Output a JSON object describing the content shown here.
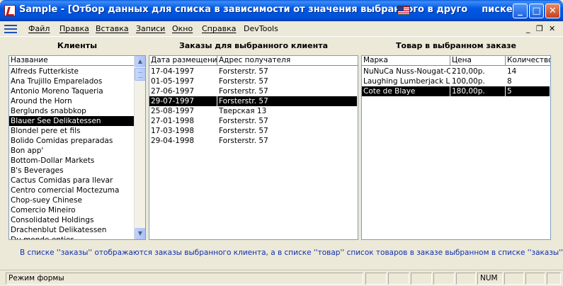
{
  "window": {
    "title_part1": "Sample - [Отбор данных для списка в зависимости от значения выбранного в друго",
    "title_part2": "писке]",
    "min_glyph": "_",
    "max_glyph": "□",
    "close_glyph": "✕"
  },
  "menu": {
    "items": [
      "Файл",
      "Правка",
      "Вставка",
      "Записи",
      "Окно",
      "Справка",
      "DevTools"
    ],
    "mdi_min": "_",
    "mdi_restore": "❐",
    "mdi_close": "✕"
  },
  "clients": {
    "title": "Клиенты",
    "header": "Название",
    "items": [
      "Alfreds Futterkiste",
      "Ana Trujillo Emparelados",
      "Antonio Moreno Taqueria",
      "Around the Horn",
      "Berglunds snabbkop",
      "Blauer See Delikatessen",
      "Blondel pere et fils",
      "Bolido Comidas preparadas",
      "Bon app'",
      "Bottom-Dollar Markets",
      "B's Beverages",
      "Cactus Comidas para llevar",
      "Centro comercial Moctezuma",
      "Chop-suey Chinese",
      "Comercio Mineiro",
      "Consolidated Holdings",
      "Drachenblut Delikatessen",
      "Du monde entier"
    ],
    "selected_index": 5,
    "scroll_up": "▲",
    "scroll_down": "▼"
  },
  "orders": {
    "title": "Заказы для выбранного клиента",
    "headers": [
      "Дата размещения",
      "Адрес получателя"
    ],
    "rows": [
      [
        "17-04-1997",
        "Forsterstr. 57"
      ],
      [
        "01-05-1997",
        "Forsterstr. 57"
      ],
      [
        "27-06-1997",
        "Forsterstr. 57"
      ],
      [
        "29-07-1997",
        "Forsterstr. 57"
      ],
      [
        "25-08-1997",
        "Тверская 13"
      ],
      [
        "27-01-1998",
        "Forsterstr. 57"
      ],
      [
        "17-03-1998",
        "Forsterstr. 57"
      ],
      [
        "29-04-1998",
        "Forsterstr. 57"
      ]
    ],
    "selected_index": 3
  },
  "products": {
    "title": "Товар в выбранном заказе",
    "headers": [
      "Марка",
      "Цена",
      "Количество"
    ],
    "rows": [
      [
        "NuNuCa Nuss-Nougat-Creme",
        "210,00р.",
        "14"
      ],
      [
        "Laughing Lumberjack Lager",
        "100,00р.",
        "8"
      ],
      [
        "Cote de Blaye",
        "180,00р.",
        "5"
      ]
    ],
    "selected_index": 2
  },
  "info_text": "В списке ''заказы'' отображаются заказы выбранного клиента, а в списке ''товар''  список товаров в заказе выбранном в списке ''заказы''.",
  "status": {
    "mode": "Режим формы",
    "num": "NUM"
  }
}
